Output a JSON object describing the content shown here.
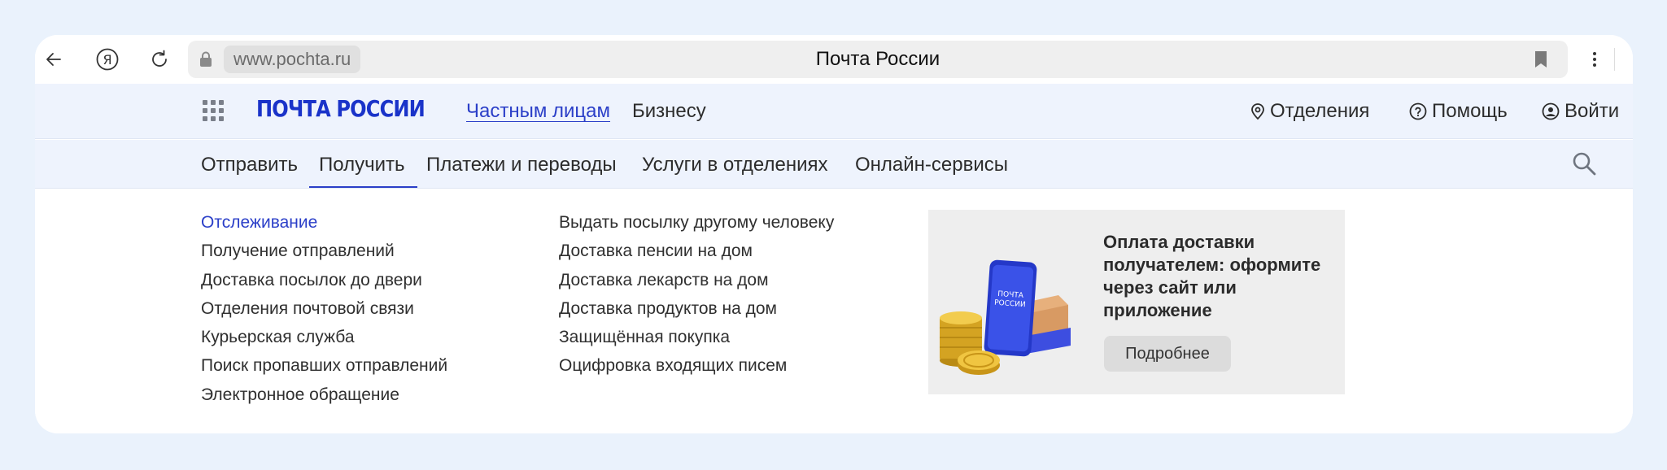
{
  "browser": {
    "url": "www.pochta.ru",
    "title": "Почта России"
  },
  "header": {
    "logo_text": "ПОЧТА РОССИИ",
    "segments": [
      {
        "label": "Частным лицам",
        "active": true
      },
      {
        "label": "Бизнесу",
        "active": false
      }
    ],
    "offices_label": "Отделения",
    "help_label": "Помощь",
    "login_label": "Войти"
  },
  "subnav": {
    "items": [
      {
        "label": "Отправить"
      },
      {
        "label": "Получить",
        "active": true
      },
      {
        "label": "Платежи и переводы"
      },
      {
        "label": "Услуги в отделениях"
      },
      {
        "label": "Онлайн-сервисы"
      }
    ]
  },
  "dropdown": {
    "col1": [
      {
        "label": "Отслеживание",
        "active": true
      },
      {
        "label": "Получение отправлений"
      },
      {
        "label": "Доставка посылок до двери"
      },
      {
        "label": "Отделения почтовой связи"
      },
      {
        "label": "Курьерская служба"
      },
      {
        "label": "Поиск пропавших отправлений"
      },
      {
        "label": "Электронное обращение"
      }
    ],
    "col2": [
      {
        "label": "Выдать посылку другому человеку"
      },
      {
        "label": "Доставка пенсии на дом"
      },
      {
        "label": "Доставка лекарств на дом"
      },
      {
        "label": "Доставка продуктов на дом"
      },
      {
        "label": "Защищённая покупка"
      },
      {
        "label": "Оцифровка входящих писем"
      }
    ],
    "promo": {
      "title": "Оплата доставки получателем: оформите через сайт или приложение",
      "button": "Подробнее",
      "phone_text_1": "ПОЧТА",
      "phone_text_2": "РОССИИ"
    }
  },
  "colors": {
    "accent": "#2b3fc8",
    "header_bg": "#eef3fd",
    "page_bg": "#eaf2fc"
  }
}
